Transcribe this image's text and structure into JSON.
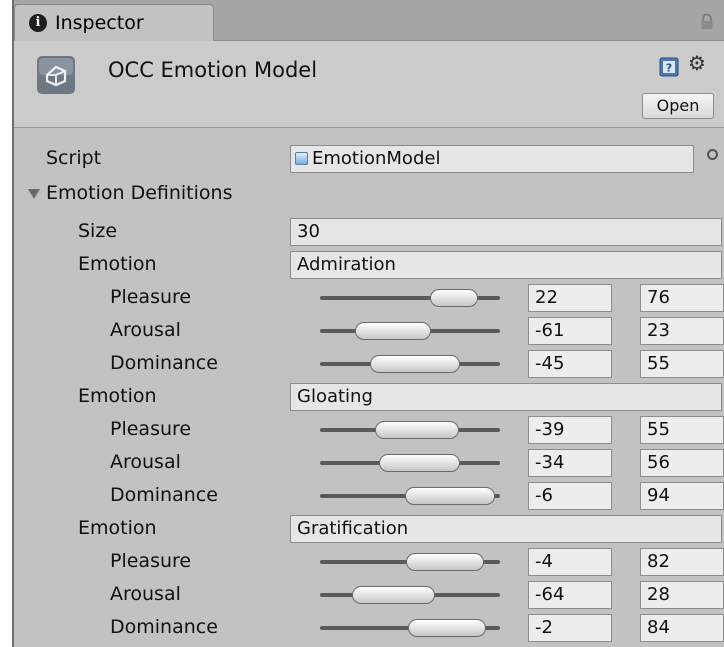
{
  "tab": {
    "icon": "info-icon",
    "title": "Inspector",
    "lock_icon": "lock-icon"
  },
  "header": {
    "title": "OCC Emotion Model",
    "asset_icon": "unity-asset-icon",
    "help_icon": "help-icon",
    "settings_icon": "gear-icon",
    "open_label": "Open"
  },
  "script": {
    "label": "Script",
    "value": "EmotionModel",
    "picker_icon": "object-picker-icon"
  },
  "definitions": {
    "label": "Emotion Definitions",
    "size_label": "Size",
    "size_value": "30",
    "emotions": [
      {
        "label": "Emotion",
        "name": "Admiration",
        "dims": [
          {
            "label": "Pleasure",
            "min": "22",
            "max": "76"
          },
          {
            "label": "Arousal",
            "min": "-61",
            "max": "23"
          },
          {
            "label": "Dominance",
            "min": "-45",
            "max": "55"
          }
        ]
      },
      {
        "label": "Emotion",
        "name": "Gloating",
        "dims": [
          {
            "label": "Pleasure",
            "min": "-39",
            "max": "55"
          },
          {
            "label": "Arousal",
            "min": "-34",
            "max": "56"
          },
          {
            "label": "Dominance",
            "min": "-6",
            "max": "94"
          }
        ]
      },
      {
        "label": "Emotion",
        "name": "Gratification",
        "dims": [
          {
            "label": "Pleasure",
            "min": "-4",
            "max": "82"
          },
          {
            "label": "Arousal",
            "min": "-64",
            "max": "28"
          },
          {
            "label": "Dominance",
            "min": "-2",
            "max": "84"
          }
        ]
      }
    ]
  },
  "slider_range": {
    "min": -100,
    "max": 100
  }
}
